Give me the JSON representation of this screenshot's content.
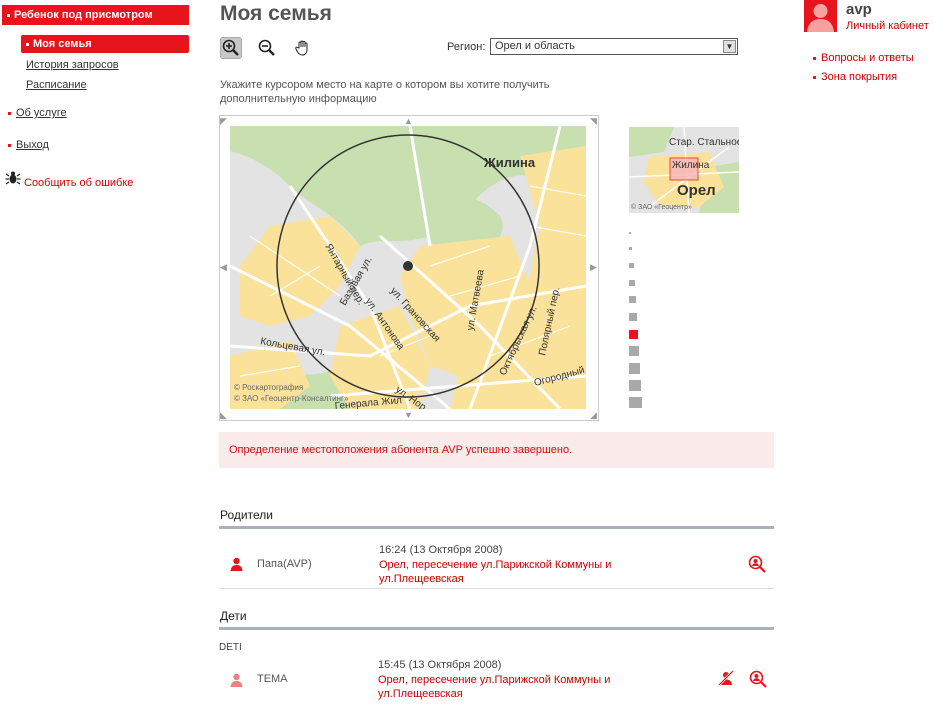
{
  "sidebar": {
    "header": "Ребенок под присмотром",
    "active_item": "Моя семья",
    "sub_items": [
      "История запросов",
      "Расписание"
    ],
    "about": "Об услуге",
    "logout": "Выход",
    "report_error": "Сообщить об ошибке"
  },
  "page": {
    "title": "Моя семья",
    "hint": "Укажите курсором место на карте о котором вы хотите получить дополнительную информацию"
  },
  "toolbar": {
    "tools": [
      "zoom-in-icon",
      "zoom-out-icon",
      "pan-hand-icon"
    ],
    "active_tool": "zoom-in-icon"
  },
  "region": {
    "label": "Регион:",
    "selected": "Орел и область"
  },
  "map": {
    "labels": {
      "district": "Жилина",
      "street_yantarny": "Янтарный пер.",
      "street_bazovaya": "Базовая ул.",
      "street_antonova": "ул. Антонова",
      "street_granovskaya": "ул. Грановская",
      "street_matveeva": "ул. Матвеева",
      "street_koltsevaya": "Кольцевая ул.",
      "street_oktyabrskaya": "Октябрьская ул.",
      "street_polyarny": "Полярный пер.",
      "street_ogorodny": "Огородный",
      "street_ul": "ул. Нор",
      "street_generala": "Генерала Жил",
      "copyright1": "© Роскартография",
      "copyright2": "© ЗАО «Геоцентр-Консалтинг»"
    },
    "minimap_labels": {
      "place1": "Стар. Стальное",
      "place2": "Жилина",
      "city": "Орел",
      "copyright": "© ЗАО «Геоцентр»"
    },
    "zoom_levels": 11,
    "current_zoom_level": 7
  },
  "user": {
    "name": "avp",
    "cabinet_link": "Личный кабинет"
  },
  "right_links": [
    "Вопросы и ответы",
    "Зона покрытия"
  ],
  "status_message": "Определение местоположения абонента AVP успешно завершено.",
  "parents": {
    "title": "Родители",
    "rows": [
      {
        "name": "Папа(AVP)",
        "time": "16:24 (13 Октября 2008)",
        "address": "Орел, пересечение ул.Парижской Коммуны и ул.Плещеевская"
      }
    ]
  },
  "children": {
    "title": "Дети",
    "group": "DETI",
    "rows": [
      {
        "name": "ТЕМА",
        "time": "15:45 (13 Октября 2008)",
        "address": "Орел, пересечение ул.Парижской Коммуны и ул.Плещеевская"
      }
    ]
  },
  "colors": {
    "accent": "#e8141b",
    "status_bg": "#fcebeb",
    "section_line": "#a9b3bd",
    "map_urban": "#fbe29a",
    "map_green": "#c8dfb0",
    "map_gray": "#e3e3e3"
  }
}
